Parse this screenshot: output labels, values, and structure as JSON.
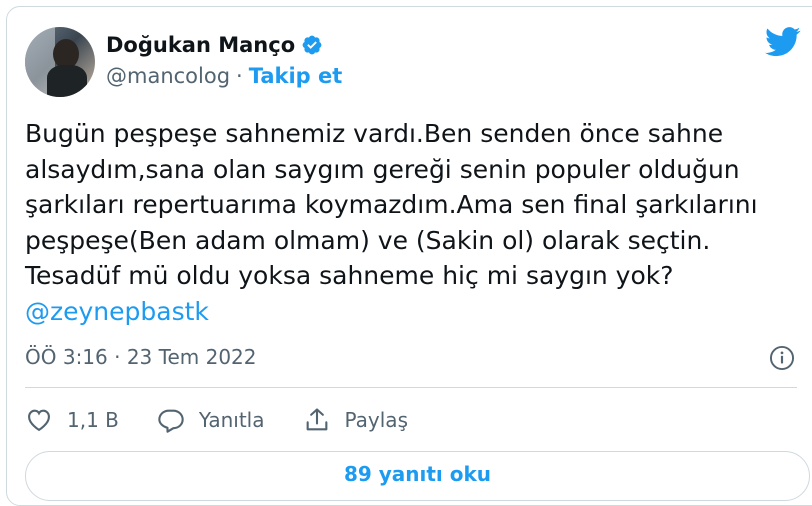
{
  "author": {
    "name": "Doğukan Manço",
    "handle": "@mancolog",
    "separator": "·",
    "follow_label": "Takip et"
  },
  "tweet": {
    "text": "Bugün peşpeşe sahnemiz vardı.Ben senden önce sahne alsaydım,sana olan saygım gereği senin populer olduğun şarkıları repertuarıma koymazdım.Ama sen final şarkılarını peşpeşe(Ben adam olmam) ve (Sakin ol) olarak seçtin. Tesadüf mü oldu yoksa sahneme hiç mi saygın yok?",
    "mention": "@zeynepbastk",
    "timestamp": "ÖÖ 3:16 · 23 Tem 2022"
  },
  "actions": {
    "like_count": "1,1 B",
    "reply_label": "Yanıtla",
    "share_label": "Paylaş"
  },
  "replies_button": "89 yanıtı oku",
  "colors": {
    "accent": "#1d9bf0",
    "text": "#0f1419",
    "secondary": "#536471",
    "border": "#cfd9de"
  },
  "icons": [
    "verified-badge-icon",
    "twitter-bird-icon",
    "info-icon",
    "heart-icon",
    "reply-bubble-icon",
    "share-icon"
  ]
}
